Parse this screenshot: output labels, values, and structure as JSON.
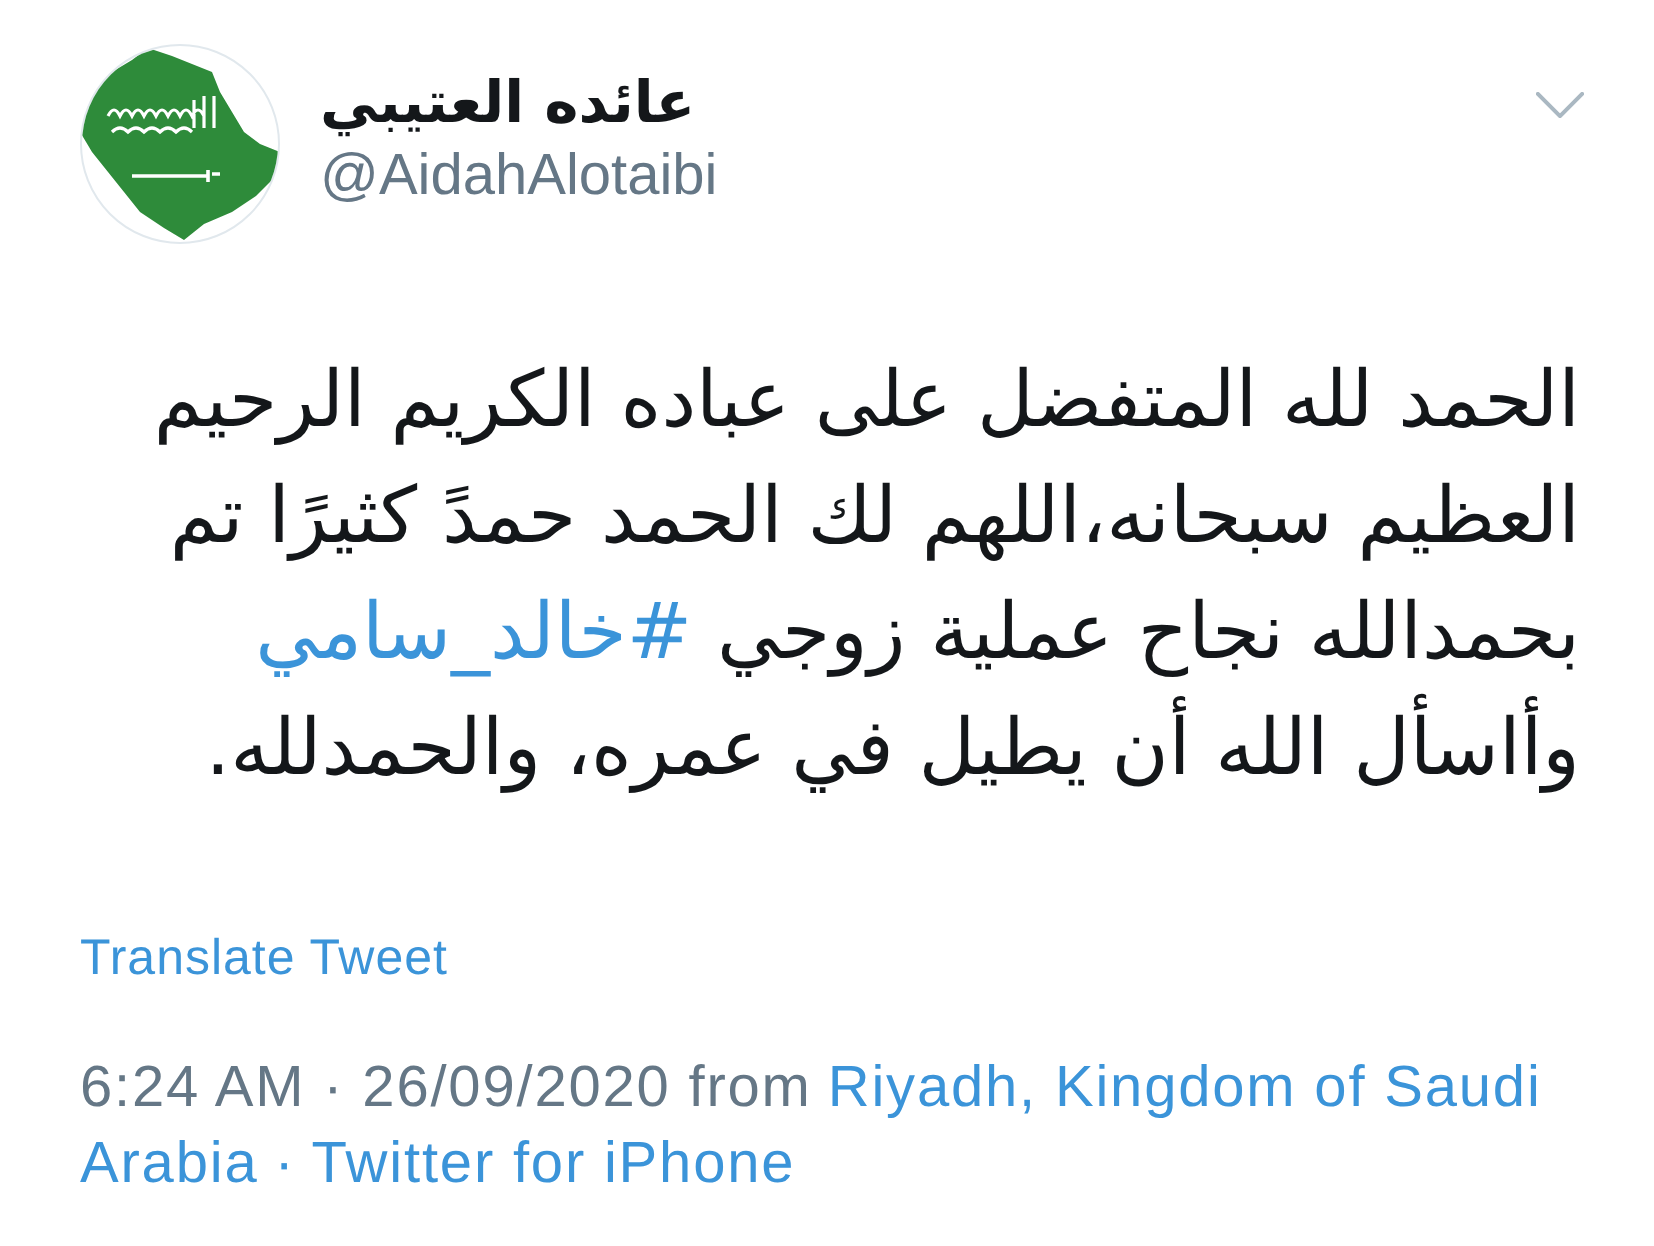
{
  "author": {
    "name": "عائده العتيبي",
    "handle": "@AidahAlotaibi"
  },
  "tweet": {
    "segments": [
      {
        "kind": "text",
        "text": "الحمد لله المتفضل على عباده الكريم الرحيم العظيم سبحانه،اللهم لك الحمد حمدً كثيرًا تم بحمدالله نجاح عملية زوجي "
      },
      {
        "kind": "hashtag",
        "text": "#خالد_سامي"
      },
      {
        "kind": "text",
        "text": " وأاسأل الله أن يطيل في عمره، والحمدلله."
      }
    ]
  },
  "translate_link": "Translate Tweet",
  "meta": {
    "timestamp": "6:24 AM · 26/09/2020 from",
    "location": [
      "Riyadh, Kingdom of Saudi",
      "Arabia"
    ],
    "separator": "·",
    "source": "Twitter for iPhone"
  }
}
